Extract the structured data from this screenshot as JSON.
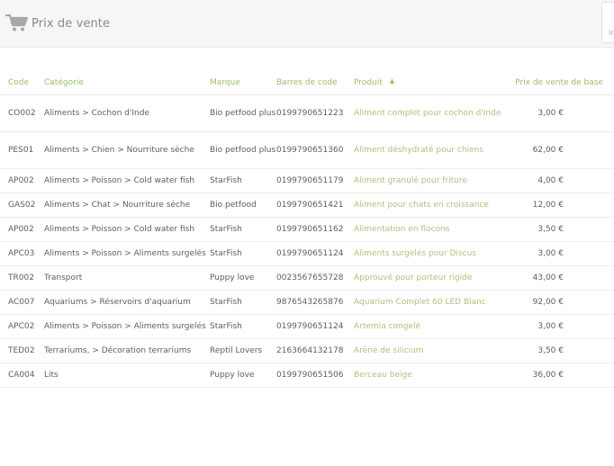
{
  "header": {
    "title": "Prix de vente",
    "right_box_text": "Ir"
  },
  "table": {
    "columns": [
      "Code",
      "Catégorie",
      "Marque",
      "Barres de code",
      "Produit",
      "Prix de vente de base"
    ],
    "sort_column": "Produit",
    "sort_direction": "ascending",
    "rows": [
      {
        "code": "CO002",
        "categorie": "Aliments > Cochon d'Inde",
        "marque": "Bio petfood plus",
        "barres": "0199790651223",
        "produit": "Aliment complet pour cochon d'Inde",
        "prix": "3,00 €"
      },
      {
        "code": "PES01",
        "categorie": "Aliments > Chien > Nourriture sèche",
        "marque": "Bio petfood plus",
        "barres": "0199790651360",
        "produit": "Aliment déshydraté pour chiens",
        "prix": "62,00 €"
      },
      {
        "code": "AP002",
        "categorie": "Aliments > Poisson > Cold water fish",
        "marque": "StarFish",
        "barres": "0199790651179",
        "produit": "Aliment granulé pour friture",
        "prix": "4,00 €"
      },
      {
        "code": "GAS02",
        "categorie": "Aliments > Chat > Nourriture sèche",
        "marque": "Bio petfood",
        "barres": "0199790651421",
        "produit": "Aliment pour chats en croissance",
        "prix": "12,00 €"
      },
      {
        "code": "AP002",
        "categorie": "Aliments > Poisson > Cold water fish",
        "marque": "StarFish",
        "barres": "0199790651162",
        "produit": "Alimentation en flocons",
        "prix": "3,50 €"
      },
      {
        "code": "APC03",
        "categorie": "Aliments > Poisson > Aliments surgelés",
        "marque": "StarFish",
        "barres": "0199790651124",
        "produit": "Aliments surgelés pour Discus",
        "prix": "3,00 €"
      },
      {
        "code": "TR002",
        "categorie": "Transport",
        "marque": "Puppy love",
        "barres": "0023567655728",
        "produit": "Approuvé pour porteur rigide",
        "prix": "43,00 €"
      },
      {
        "code": "AC007",
        "categorie": "Aquariums > Réservoirs d'aquarium",
        "marque": "StarFish",
        "barres": "9876543265876",
        "produit": "Aquarium Complet 60 LED Blanc",
        "prix": "92,00 €"
      },
      {
        "code": "APC02",
        "categorie": "Aliments > Poisson > Aliments surgelés",
        "marque": "StarFish",
        "barres": "0199790651124",
        "produit": "Artemia congelé",
        "prix": "3,00 €"
      },
      {
        "code": "TED02",
        "categorie": "Terrariums, > Décoration terrariums",
        "marque": "Reptil Lovers",
        "barres": "2163664132178",
        "produit": "Arène de silicium",
        "prix": "3,50 €"
      },
      {
        "code": "CA004",
        "categorie": "Lits",
        "marque": "Puppy love",
        "barres": "0199790651506",
        "produit": "Berceau beige",
        "prix": "36,00 €"
      }
    ]
  },
  "colors": {
    "accent": "#9cbd6c",
    "product_link": "#a9c47e",
    "topbar_bg": "#f6f6f6",
    "text": "#5e5e5e"
  },
  "icons": {
    "cart": "cart-icon",
    "sort": "sort-ascending-icon"
  }
}
